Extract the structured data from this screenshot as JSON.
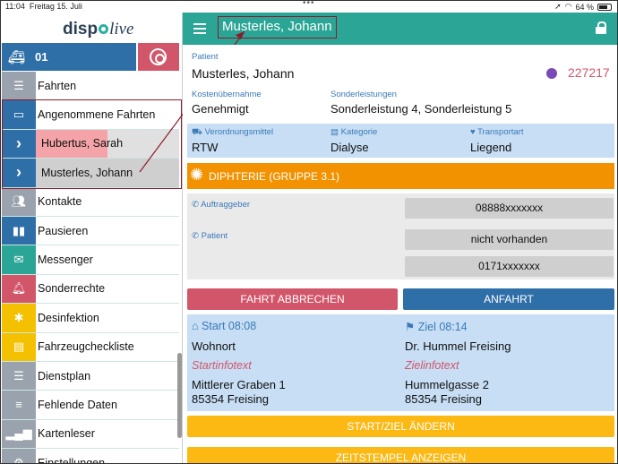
{
  "status": {
    "time": "11:04",
    "date": "Freitag 15. Juli",
    "battery": "64 %"
  },
  "logo": {
    "text_left": "disp",
    "text_right": "live"
  },
  "vehicle": {
    "number": "01"
  },
  "menu": [
    {
      "label": "Fahrten",
      "icon": "list-icon",
      "color": "#9aa3ad"
    },
    {
      "label": "Angenommene Fahrten",
      "icon": "id-card-icon",
      "color": "#2f6fa8"
    },
    {
      "label": "Hubertus, Sarah",
      "icon": "chevron-right-icon",
      "sub": true,
      "bg": "#f4a3a8"
    },
    {
      "label": "Musterles, Johann",
      "icon": "chevron-right-icon",
      "sub": true,
      "bg": "#cfcfcf"
    },
    {
      "label": "Kontakte",
      "icon": "people-icon",
      "color": "#9aa3ad"
    },
    {
      "label": "Pausieren",
      "icon": "pause-icon",
      "color": "#2f6fa8"
    },
    {
      "label": "Messenger",
      "icon": "mail-icon",
      "color": "#2ba595"
    },
    {
      "label": "Sonderrechte",
      "icon": "bell-icon",
      "color": "#d2566a"
    },
    {
      "label": "Desinfektion",
      "icon": "bug-icon",
      "color": "#f3c100"
    },
    {
      "label": "Fahrzeugcheckliste",
      "icon": "clipboard-icon",
      "color": "#f3c100"
    },
    {
      "label": "Dienstplan",
      "icon": "list-icon",
      "color": "#9aa3ad"
    },
    {
      "label": "Fehlende Daten",
      "icon": "database-icon",
      "color": "#9aa3ad"
    },
    {
      "label": "Kartenleser",
      "icon": "signal-icon",
      "color": "#9aa3ad"
    },
    {
      "label": "Einstellungen",
      "icon": "gear-icon",
      "color": "#9aa3ad"
    }
  ],
  "header": {
    "title": "Musterles, Johann"
  },
  "patient": {
    "label": "Patient",
    "name": "Musterles, Johann",
    "number": "227217",
    "kosten_label": "Kostenübernahme",
    "kosten": "Genehmigt",
    "sonder_label": "Sonderleistungen",
    "sonder": "Sonderleistung 4, Sonderleistung 5"
  },
  "info": {
    "vo_label": "Verordnungsmittel",
    "vo": "RTW",
    "kat_label": "Kategorie",
    "kat": "Dialyse",
    "tr_label": "Transportart",
    "tr": "Liegend"
  },
  "infection": {
    "label": "DIPHTERIE (GRUPPE 3.1)"
  },
  "contacts": {
    "auftraggeber_label": "Auftraggeber",
    "auftraggeber_phone": "08888xxxxxxx",
    "patient_label": "Patient",
    "patient_phone1": "nicht vorhanden",
    "patient_phone2": "0171xxxxxxx"
  },
  "actions": {
    "abort": "FAHRT ABBRECHEN",
    "approach": "ANFAHRT",
    "change": "START/ZIEL ÄNDERN",
    "timestamps": "ZEITSTEMPEL ANZEIGEN"
  },
  "route": {
    "start_label": "Start 08:08",
    "start_name": "Wohnort",
    "start_info": "Startinfotext",
    "start_street": "Mittlerer Graben 1",
    "start_city": "85354 Freising",
    "ziel_label": "Ziel 08:14",
    "ziel_name": "Dr. Hummel Freising",
    "ziel_info": "Zielinfotext",
    "ziel_street": "Hummelgasse 2",
    "ziel_city": "85354 Freising"
  },
  "colors": {
    "teal": "#2ba595",
    "blue": "#2f6fa8",
    "red": "#d2566a",
    "orange": "#f39200",
    "yellow": "#fdb913",
    "purple": "#7a4ab8"
  }
}
